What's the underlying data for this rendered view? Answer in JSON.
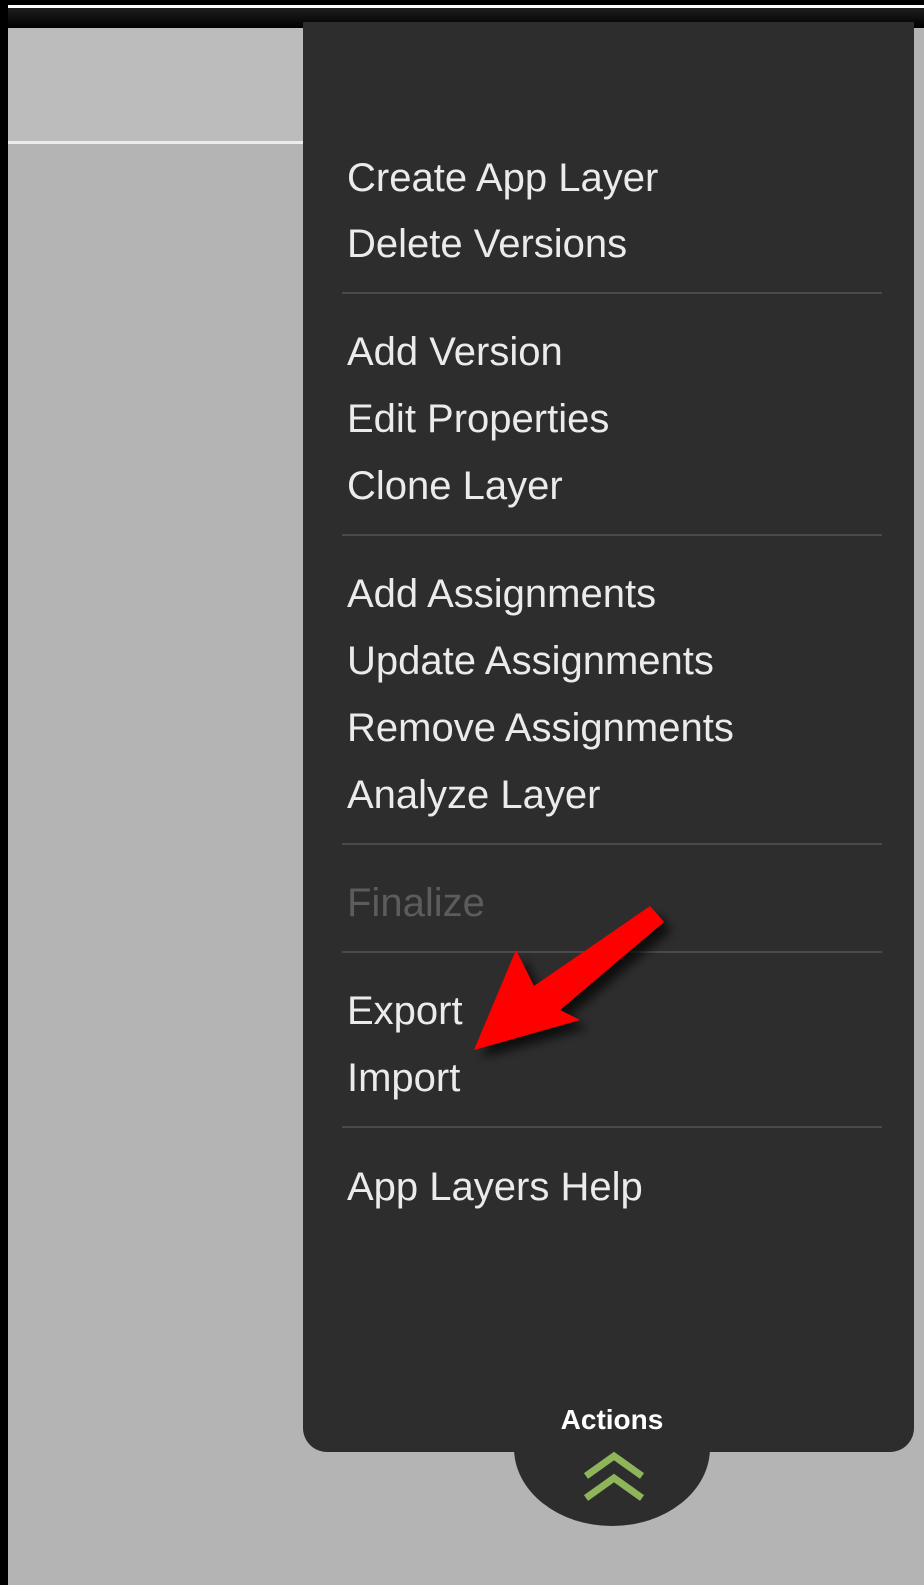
{
  "menu": {
    "items": [
      {
        "label": "Create App Layer",
        "enabled": true
      },
      {
        "label": "Delete Versions",
        "enabled": true
      },
      {
        "label": "Add Version",
        "enabled": true
      },
      {
        "label": "Edit Properties",
        "enabled": true
      },
      {
        "label": "Clone Layer",
        "enabled": true
      },
      {
        "label": "Add Assignments",
        "enabled": true
      },
      {
        "label": "Update Assignments",
        "enabled": true
      },
      {
        "label": "Remove Assignments",
        "enabled": true
      },
      {
        "label": "Analyze Layer",
        "enabled": true
      },
      {
        "label": "Finalize",
        "enabled": false
      },
      {
        "label": "Export",
        "enabled": true
      },
      {
        "label": "Import",
        "enabled": true
      },
      {
        "label": "App Layers Help",
        "enabled": true
      }
    ]
  },
  "actions_tab": {
    "label": "Actions",
    "icon": "double-chevron-up-icon"
  },
  "colors": {
    "panel_bg": "#2d2d2d",
    "page_bg": "#b4b4b4",
    "menu_text": "#ebebeb",
    "disabled_text": "#5c5c5c",
    "chevron": "#8fb55a",
    "annotation_arrow": "#ff0000"
  }
}
